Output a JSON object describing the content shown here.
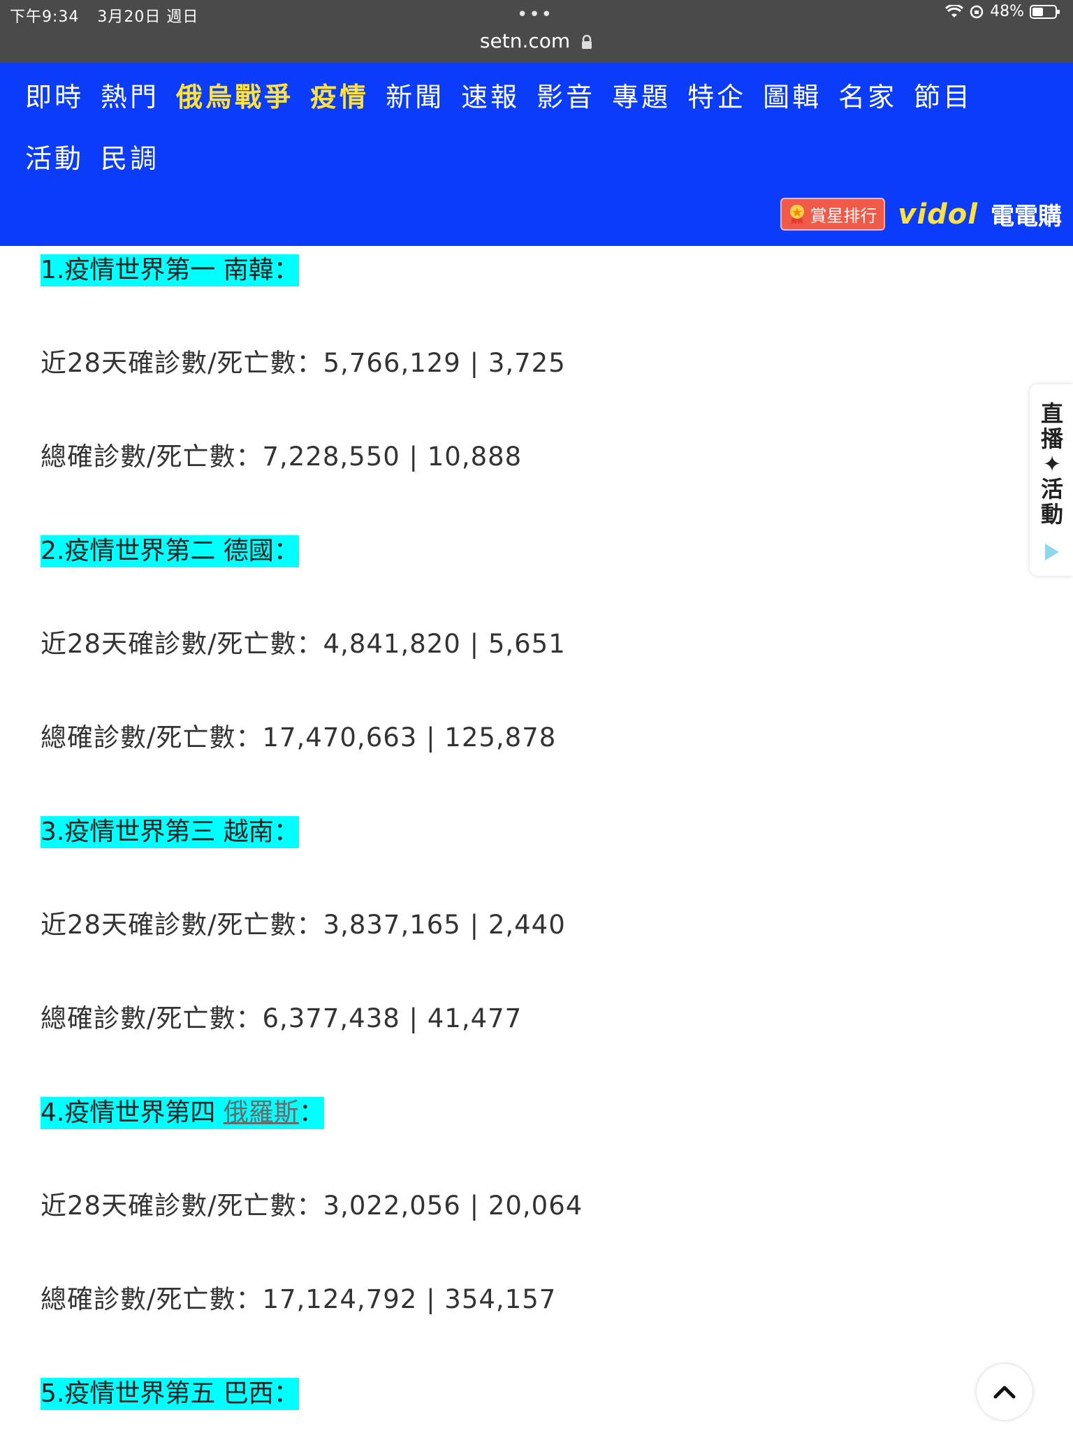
{
  "status_bar": {
    "time": "下午9:34",
    "date": "3月20日 週日",
    "dots": "•••",
    "battery": "48%",
    "icons": [
      "wifi-icon",
      "lock-rotation-icon",
      "battery-icon"
    ]
  },
  "address_bar": {
    "url": "setn.com",
    "icon": "lock-icon"
  },
  "nav": {
    "row1": [
      "即時",
      "熱門",
      "俄烏戰爭",
      "疫情",
      "新聞",
      "速報",
      "影音",
      "專題",
      "特企",
      "圖輯",
      "名家",
      "節目"
    ],
    "row2": [
      "活動",
      "民調"
    ],
    "highlight_items": [
      "俄烏戰爭",
      "疫情"
    ],
    "rank_badge": "賞星排行",
    "brand_vidol": "vidol",
    "brand_shop": "電電購",
    "colors": {
      "bg": "#0a3cfa",
      "highlight": "#ffe23b",
      "text": "#ffffff"
    }
  },
  "side_tab": {
    "text": "直播✦活動",
    "icon": "play-icon"
  },
  "articles": [
    {
      "title_prefix": "1.疫情世界第一 ",
      "country": "南韓",
      "title_suffix": "：",
      "recent": "近28天確診數/死亡數：5,766,129 | 3,725",
      "total": "總確診數/死亡數：7,228,550 | 10,888"
    },
    {
      "title_prefix": "2.疫情世界第二 ",
      "country": "德國",
      "title_suffix": "：",
      "recent": "近28天確診數/死亡數：4,841,820 | 5,651",
      "total": "總確診數/死亡數：17,470,663 | 125,878"
    },
    {
      "title_prefix": "3.疫情世界第三 ",
      "country": "越南",
      "title_suffix": "：",
      "recent": "近28天確診數/死亡數：3,837,165 | 2,440",
      "total": "總確診數/死亡數：6,377,438 | 41,477"
    },
    {
      "title_prefix": "4.疫情世界第四 ",
      "country": "俄羅斯",
      "title_suffix": "：",
      "recent": "近28天確診數/死亡數：3,022,056 | 20,064",
      "total": "總確診數/死亡數：17,124,792 | 354,157"
    },
    {
      "title_prefix": "5.疫情世界第五 ",
      "country": "巴西",
      "title_suffix": "："
    }
  ],
  "back_to_top": {
    "icon": "chevron-up-icon"
  }
}
